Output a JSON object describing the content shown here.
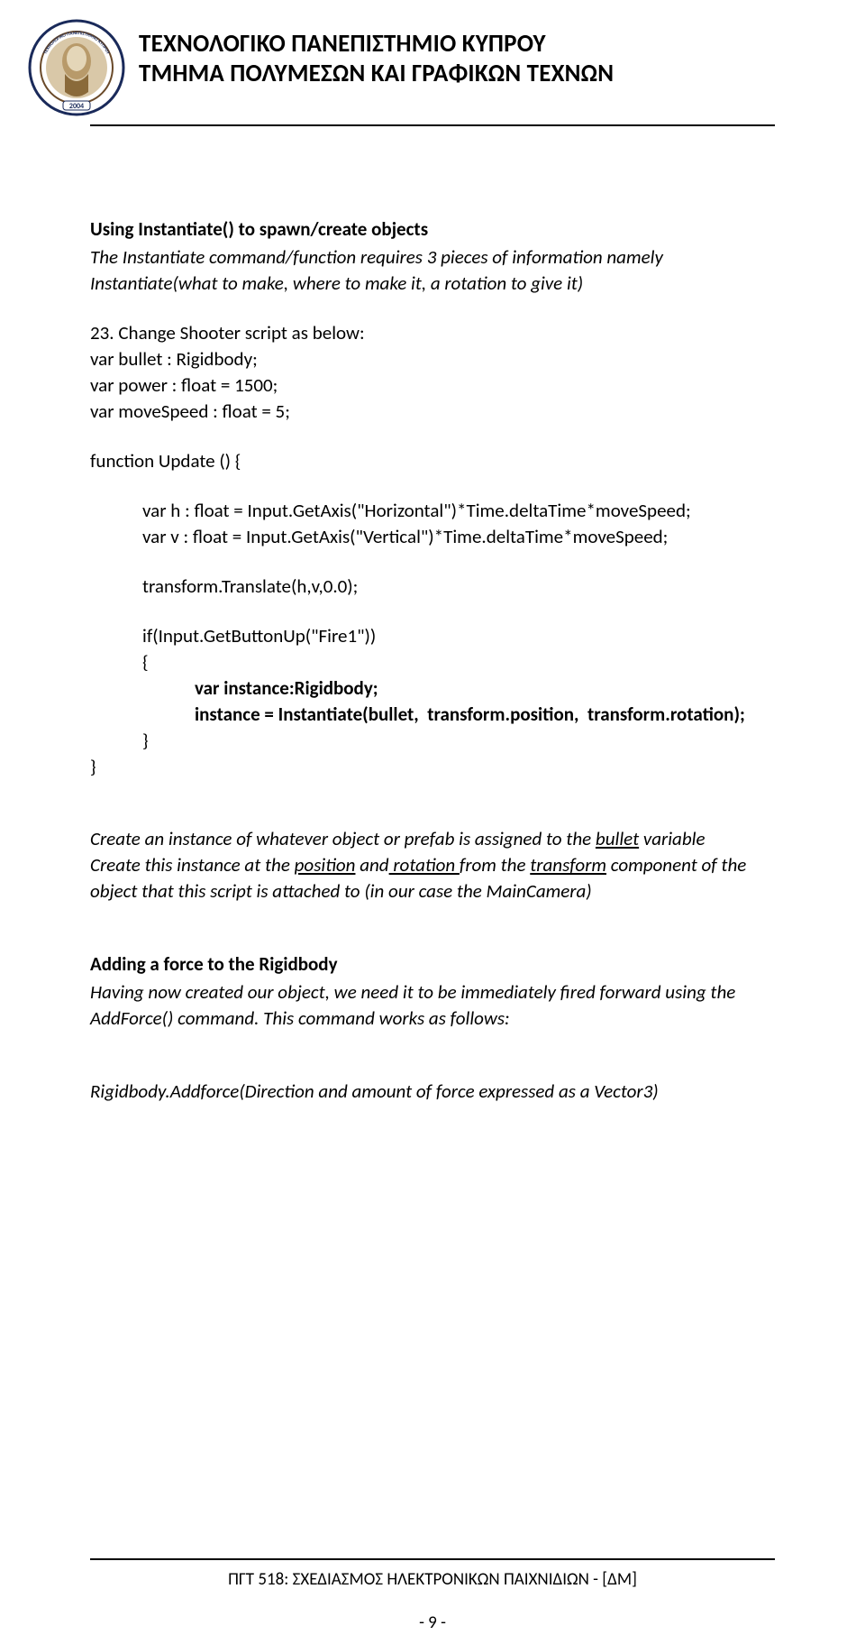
{
  "header": {
    "line1": "ΤΕΧΝΟΛΟΓΙΚΟ ΠΑΝΕΠΙΣΤΗΜΙΟ ΚΥΠΡΟΥ",
    "line2": "ΤΜΗΜΑ ΠΟΛΥΜΕΣΩΝ ΚΑΙ ΓΡΑΦΙΚΩΝ ΤΕΧΝΩΝ"
  },
  "section1": {
    "title": "Using Instantiate() to spawn/create objects",
    "body": "The Instantiate command/function requires 3 pieces of information namely Instantiate(what to make, where to make it, a rotation to give it)"
  },
  "step": {
    "num": "23.",
    "text": "Change Shooter script as below:"
  },
  "code": {
    "l1": "var bullet : Rigidbody;",
    "l2": "var power : float = 1500;",
    "l3": "var moveSpeed : float = 5;",
    "l4": "function Update () {",
    "l5": "var h : float = Input.GetAxis(\"Horizontal\")*Time.deltaTime*moveSpeed;",
    "l6": "var v : float = Input.GetAxis(\"Vertical\")*Time.deltaTime*moveSpeed;",
    "l7": "transform.Translate(h,v,0.0);",
    "l8": "if(Input.GetButtonUp(\"Fire1\"))",
    "l9": "{",
    "l10a": "var instance:Rigidbody;",
    "l10b_pre": "instance = Instantiate(bullet,  transform.position,  transform.rotation);",
    "l11": "}",
    "l12": "}"
  },
  "explain": {
    "p1_pre": "Create an instance of whatever object or prefab is assigned to the ",
    "p1_u1": "bullet",
    "p1_post": " variable",
    "p2_a": "Create this instance at the ",
    "p2_u1": "position",
    "p2_b": " and",
    "p2_u2": " rotation ",
    "p2_c": " from the ",
    "p2_u3": "transform",
    "p2_d": " component of the object that this script is attached to (in our case the MainCamera)"
  },
  "section2": {
    "title": "Adding a force to the Rigidbody",
    "body": "Having now created our object, we need it to be immediately fired forward using the AddForce() command. This command works as follows:"
  },
  "sig": "Rigidbody.Addforce(Direction and amount of force expressed as a Vector3)",
  "footer": {
    "text": "ΠΓΤ 518: ΣΧΕΔΙΑΣΜΟΣ ΗΛΕΚΤΡΟΝΙΚΩΝ ΠΑΙΧΝΙΔΙΩΝ - [ΔΜ]",
    "page": "-  9 -"
  }
}
